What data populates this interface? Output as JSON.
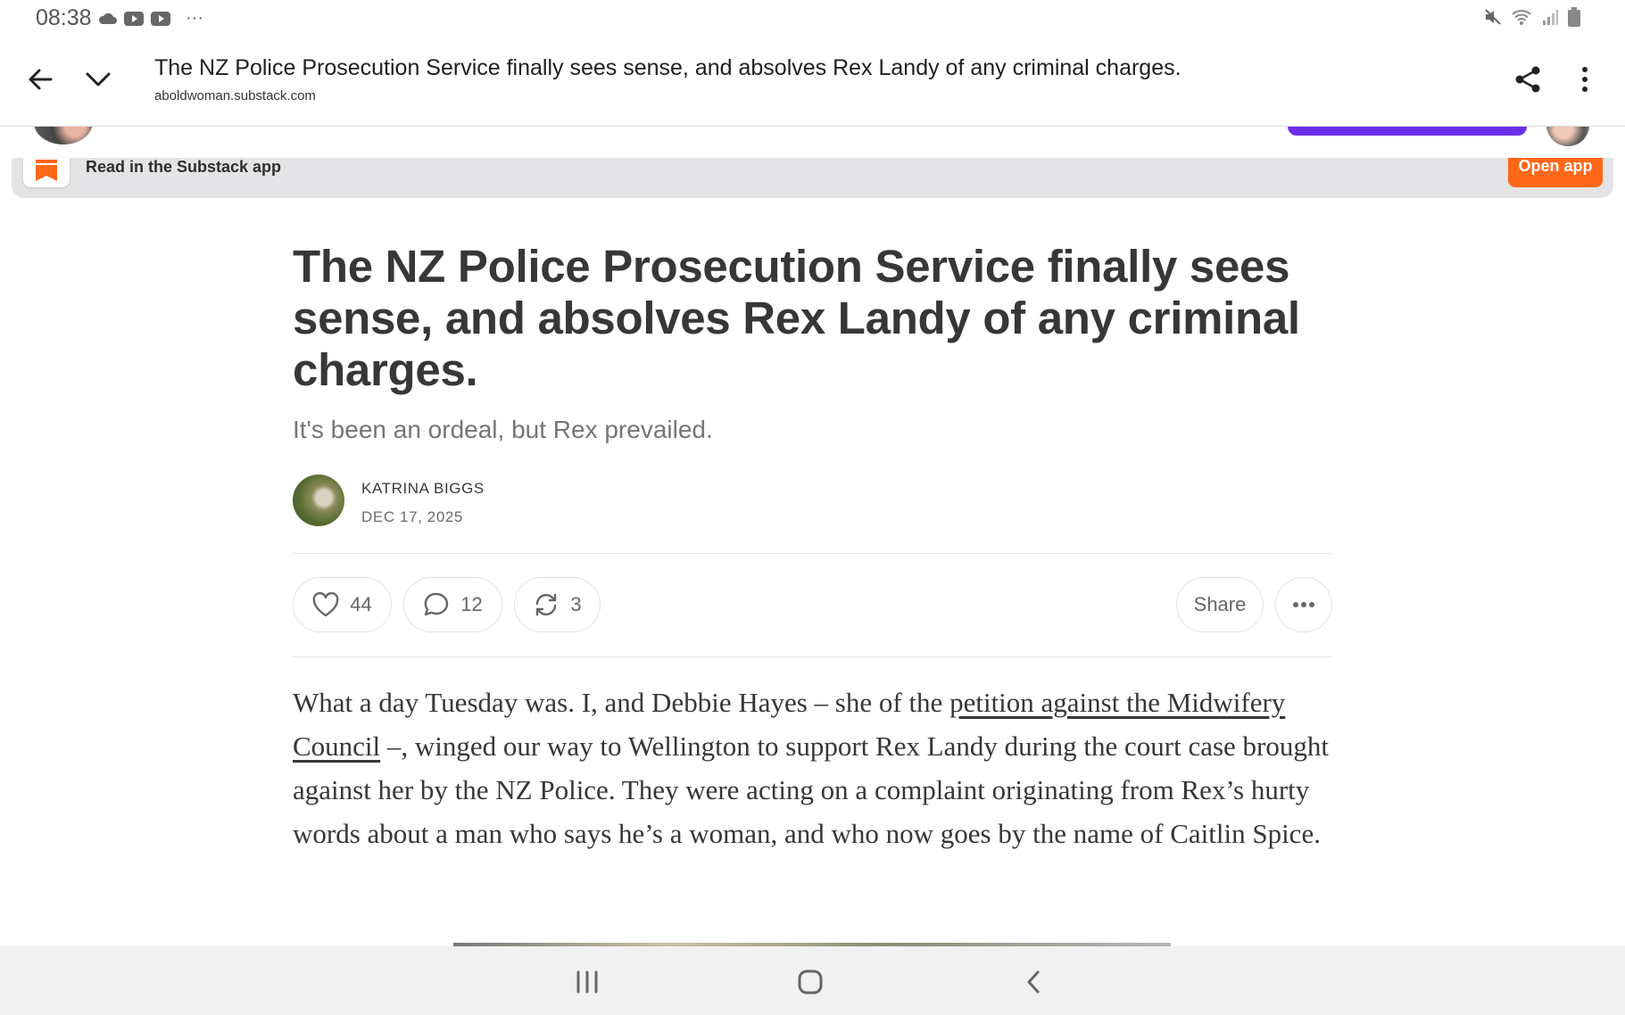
{
  "status": {
    "time": "08:38",
    "more": "···",
    "left_icons": [
      "cloud-icon",
      "youtube-icon",
      "youtube-icon"
    ],
    "right_icons": [
      "mute-icon",
      "wifi-icon",
      "signal-icon",
      "battery-icon"
    ]
  },
  "browser": {
    "page_title": "The NZ Police Prosecution Service finally sees sense, and absolves Rex Landy of any criminal charges.",
    "domain": "aboldwoman.substack.com"
  },
  "banner": {
    "text": "Read in the Substack app",
    "button": "Open app"
  },
  "article": {
    "title": "The NZ Police Prosecution Service finally sees sense, and absolves Rex Landy of any criminal charges.",
    "subtitle": "It's been an ordeal, but Rex prevailed.",
    "author": "KATRINA BIGGS",
    "date": "DEC 17, 2025",
    "likes": "44",
    "comments": "12",
    "restacks": "3",
    "share_label": "Share",
    "body": {
      "part1": "What a day Tuesday was. I, and Debbie Hayes – she of the ",
      "link": "petition against the Midwifery Council",
      "part2": " –, winged our way to Wellington to support Rex Landy during the court case brought against her by the NZ Police. They were acting on a complaint originating from Rex’s hurty words about a man who says he’s a woman, and who now goes by the name of Caitlin Spice."
    }
  },
  "colors": {
    "accent": "#ff6719",
    "purple": "#6b2ee8",
    "text": "#363737"
  }
}
